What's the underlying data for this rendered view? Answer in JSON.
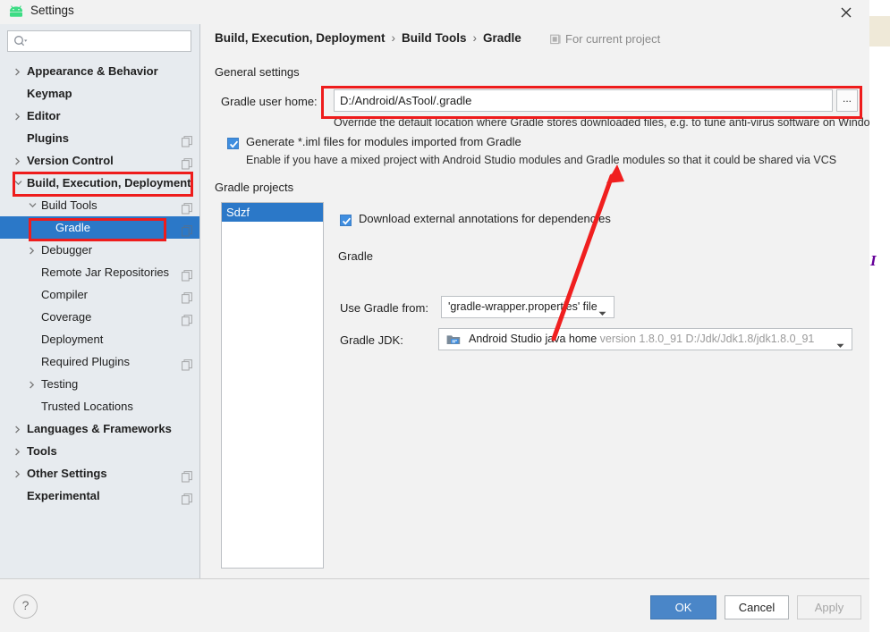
{
  "window": {
    "title": "Settings",
    "app_icon": "android-icon",
    "close_icon": "close-icon"
  },
  "sidebar": {
    "search": {
      "value": "",
      "placeholder": "",
      "icon": "search-icon"
    },
    "items": [
      {
        "label": "Appearance & Behavior",
        "depth": 0,
        "bold": true,
        "arrow": "chevron-right",
        "badge": false,
        "selected": false
      },
      {
        "label": "Keymap",
        "depth": 0,
        "bold": true,
        "arrow": "none",
        "badge": false,
        "selected": false
      },
      {
        "label": "Editor",
        "depth": 0,
        "bold": true,
        "arrow": "chevron-right",
        "badge": false,
        "selected": false
      },
      {
        "label": "Plugins",
        "depth": 0,
        "bold": true,
        "arrow": "none",
        "badge": true,
        "selected": false
      },
      {
        "label": "Version Control",
        "depth": 0,
        "bold": true,
        "arrow": "chevron-right",
        "badge": true,
        "selected": false
      },
      {
        "label": "Build, Execution, Deployment",
        "depth": 0,
        "bold": true,
        "arrow": "chevron-down",
        "badge": false,
        "selected": false
      },
      {
        "label": "Build Tools",
        "depth": 1,
        "bold": false,
        "arrow": "chevron-down",
        "badge": true,
        "selected": false
      },
      {
        "label": "Gradle",
        "depth": 2,
        "bold": false,
        "arrow": "none",
        "badge": true,
        "selected": true
      },
      {
        "label": "Debugger",
        "depth": 1,
        "bold": false,
        "arrow": "chevron-right",
        "badge": false,
        "selected": false
      },
      {
        "label": "Remote Jar Repositories",
        "depth": 1,
        "bold": false,
        "arrow": "none",
        "badge": true,
        "selected": false
      },
      {
        "label": "Compiler",
        "depth": 1,
        "bold": false,
        "arrow": "none",
        "badge": true,
        "selected": false
      },
      {
        "label": "Coverage",
        "depth": 1,
        "bold": false,
        "arrow": "none",
        "badge": true,
        "selected": false
      },
      {
        "label": "Deployment",
        "depth": 1,
        "bold": false,
        "arrow": "none",
        "badge": false,
        "selected": false
      },
      {
        "label": "Required Plugins",
        "depth": 1,
        "bold": false,
        "arrow": "none",
        "badge": true,
        "selected": false
      },
      {
        "label": "Testing",
        "depth": 1,
        "bold": false,
        "arrow": "chevron-right",
        "badge": false,
        "selected": false
      },
      {
        "label": "Trusted Locations",
        "depth": 1,
        "bold": false,
        "arrow": "none",
        "badge": false,
        "selected": false
      },
      {
        "label": "Languages & Frameworks",
        "depth": 0,
        "bold": true,
        "arrow": "chevron-right",
        "badge": false,
        "selected": false
      },
      {
        "label": "Tools",
        "depth": 0,
        "bold": true,
        "arrow": "chevron-right",
        "badge": false,
        "selected": false
      },
      {
        "label": "Other Settings",
        "depth": 0,
        "bold": true,
        "arrow": "chevron-right",
        "badge": true,
        "selected": false
      },
      {
        "label": "Experimental",
        "depth": 0,
        "bold": true,
        "arrow": "none",
        "badge": true,
        "selected": false
      }
    ]
  },
  "main": {
    "breadcrumb": {
      "part1": "Build, Execution, Deployment",
      "sep1": "›",
      "part2": "Build Tools",
      "sep2": "›",
      "part3": "Gradle"
    },
    "scope_note": {
      "label": "For current project",
      "icon": "project-scope-icon"
    },
    "general_settings": {
      "section_label": "General settings",
      "gradle_user_home": {
        "label": "Gradle user home:",
        "value": "D:/Android/AsTool/.gradle",
        "placeholder": "",
        "browse_label": "...",
        "hint": "Override the default location where Gradle stores downloaded files, e.g. to tune anti-virus software on Windows"
      },
      "generate_iml": {
        "label": "Generate *.iml files for modules imported from Gradle",
        "checked": true,
        "hint": "Enable if you have a mixed project with Android Studio modules and Gradle modules so that it could be shared via VCS"
      }
    },
    "gradle_projects": {
      "section_label": "Gradle projects",
      "projects": [
        {
          "name": "Sdzf",
          "selected": true
        }
      ],
      "download_annotations": {
        "label": "Download external annotations for dependencies",
        "checked": true
      },
      "gradle_group_label": "Gradle",
      "use_gradle_from": {
        "label": "Use Gradle from:",
        "value": "'gradle-wrapper.properties' file"
      },
      "gradle_jdk": {
        "label": "Gradle JDK:",
        "value": "Android Studio java home",
        "detail": "version 1.8.0_91 D:/Jdk/Jdk1.8/jdk1.8.0_91",
        "icon": "jdk-folder-icon"
      }
    }
  },
  "footer": {
    "help_label": "?",
    "ok_label": "OK",
    "cancel_label": "Cancel",
    "apply_label": "Apply"
  },
  "background": {
    "code_fragment": "I"
  },
  "annotations": {
    "accent_color": "#ee1c1c",
    "boxes": [
      "build-execution-deployment",
      "gradle-sidebar-item",
      "gradle-user-home-field"
    ],
    "arrow": "points-to-generate-iml-hint"
  }
}
